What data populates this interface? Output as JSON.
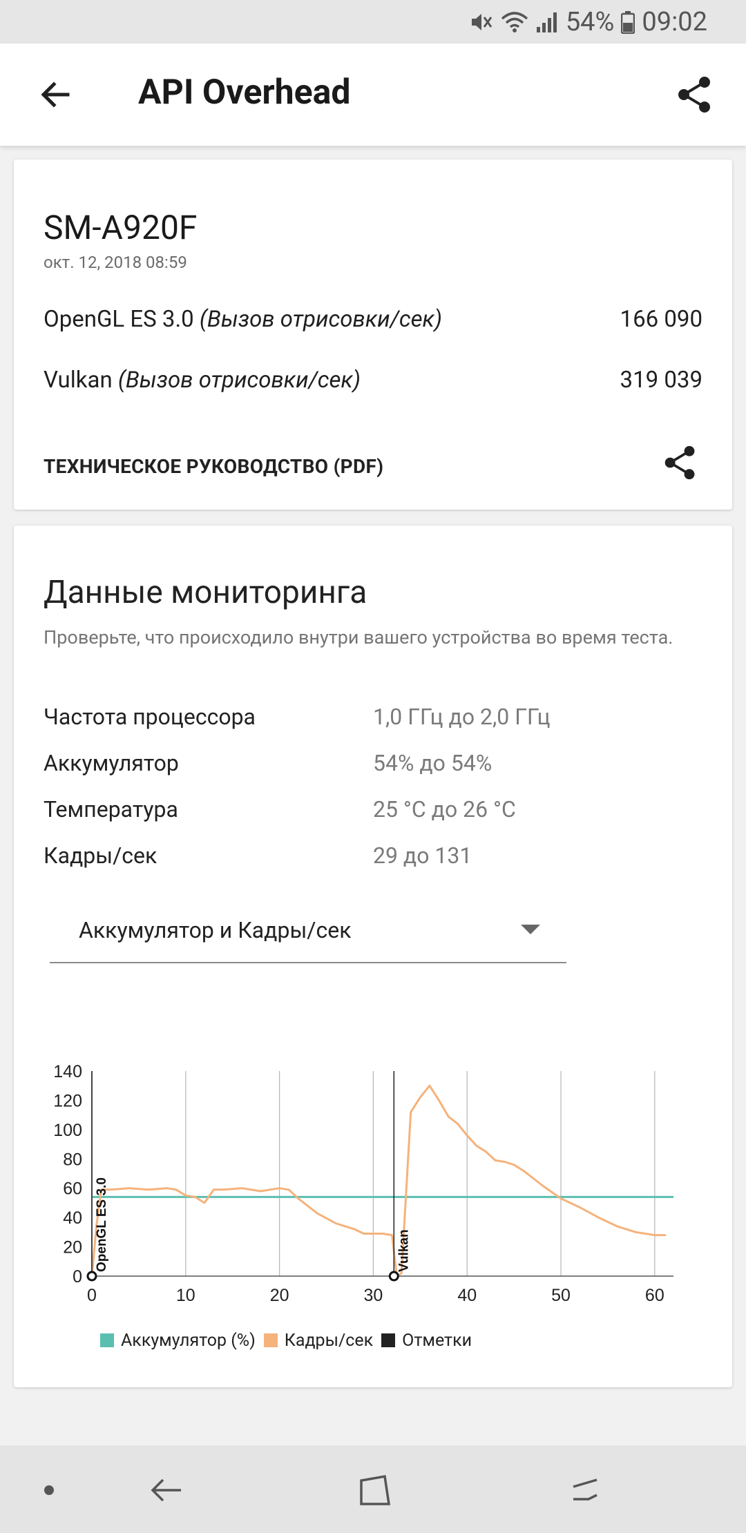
{
  "status": {
    "battery": "54%",
    "time": "09:02"
  },
  "app_bar": {
    "title": "API Overhead"
  },
  "result_card": {
    "device": "SM-A920F",
    "date": "окт. 12, 2018 08:59",
    "scores": [
      {
        "name": "OpenGL ES 3.0",
        "unit": "(Вызов отрисовки/сек)",
        "value": "166 090"
      },
      {
        "name": "Vulkan",
        "unit": "(Вызов отрисовки/сек)",
        "value": "319 039"
      }
    ],
    "pdf_link": "ТЕХНИЧЕСКОЕ РУКОВОДСТВО (PDF)"
  },
  "monitoring": {
    "title": "Данные мониторинга",
    "description": "Проверьте, что происходило внутри вашего устройства во время теста.",
    "rows": [
      {
        "label": "Частота процессора",
        "range": "1,0 ГГц до 2,0 ГГц"
      },
      {
        "label": "Аккумулятор",
        "range": "54% до 54%"
      },
      {
        "label": "Температура",
        "range": "25 °C до 26 °C"
      },
      {
        "label": "Кадры/сек",
        "range": "29 до 131"
      }
    ],
    "dropdown": {
      "selected": "Аккумулятор и Кадры/сек"
    }
  },
  "colors": {
    "battery": "#5bbfb0",
    "fps": "#f5b27b",
    "marks": "#222222"
  },
  "chart_data": {
    "type": "line",
    "title": "",
    "xlabel": "",
    "ylabel": "",
    "xlim": [
      0,
      62
    ],
    "ylim": [
      0,
      140
    ],
    "x_ticks": [
      0,
      10,
      20,
      30,
      40,
      50,
      60
    ],
    "y_ticks": [
      0,
      20,
      40,
      60,
      80,
      100,
      120,
      140
    ],
    "grid": "vertical",
    "legend": "bottom",
    "series": [
      {
        "name": "Аккумулятор (%)",
        "color": "#5bbfb0",
        "x": [
          0,
          62
        ],
        "y": [
          54,
          54
        ]
      },
      {
        "name": "Кадры/сек",
        "color": "#f5b27b",
        "x": [
          0,
          0.5,
          1,
          2,
          4,
          6,
          8,
          9,
          10,
          11,
          12,
          13,
          14,
          16,
          18,
          19,
          20,
          21,
          22,
          24,
          26,
          28,
          29,
          30,
          31,
          32,
          32.5,
          33,
          34,
          35,
          36,
          37,
          38,
          39,
          40,
          41,
          42,
          43,
          44,
          45,
          46,
          48,
          50,
          52,
          54,
          56,
          58,
          60,
          61.2
        ],
        "y": [
          0,
          35,
          59,
          59,
          60,
          59,
          60,
          59,
          55,
          54,
          50,
          59,
          59,
          60,
          58,
          59,
          60,
          59,
          53,
          43,
          36,
          32,
          29,
          29,
          29,
          28,
          0,
          2,
          112,
          122,
          130,
          120,
          109,
          104,
          96,
          89,
          85,
          79,
          78,
          76,
          72,
          62,
          53,
          47,
          40,
          34,
          30,
          28,
          28
        ]
      }
    ],
    "marks": [
      {
        "x": 0,
        "label": "OpenGL ES 3.0"
      },
      {
        "x": 32.2,
        "label": "Vulkan"
      }
    ],
    "legend_entries": [
      "Аккумулятор (%)",
      "Кадры/сек",
      "Отметки"
    ]
  }
}
